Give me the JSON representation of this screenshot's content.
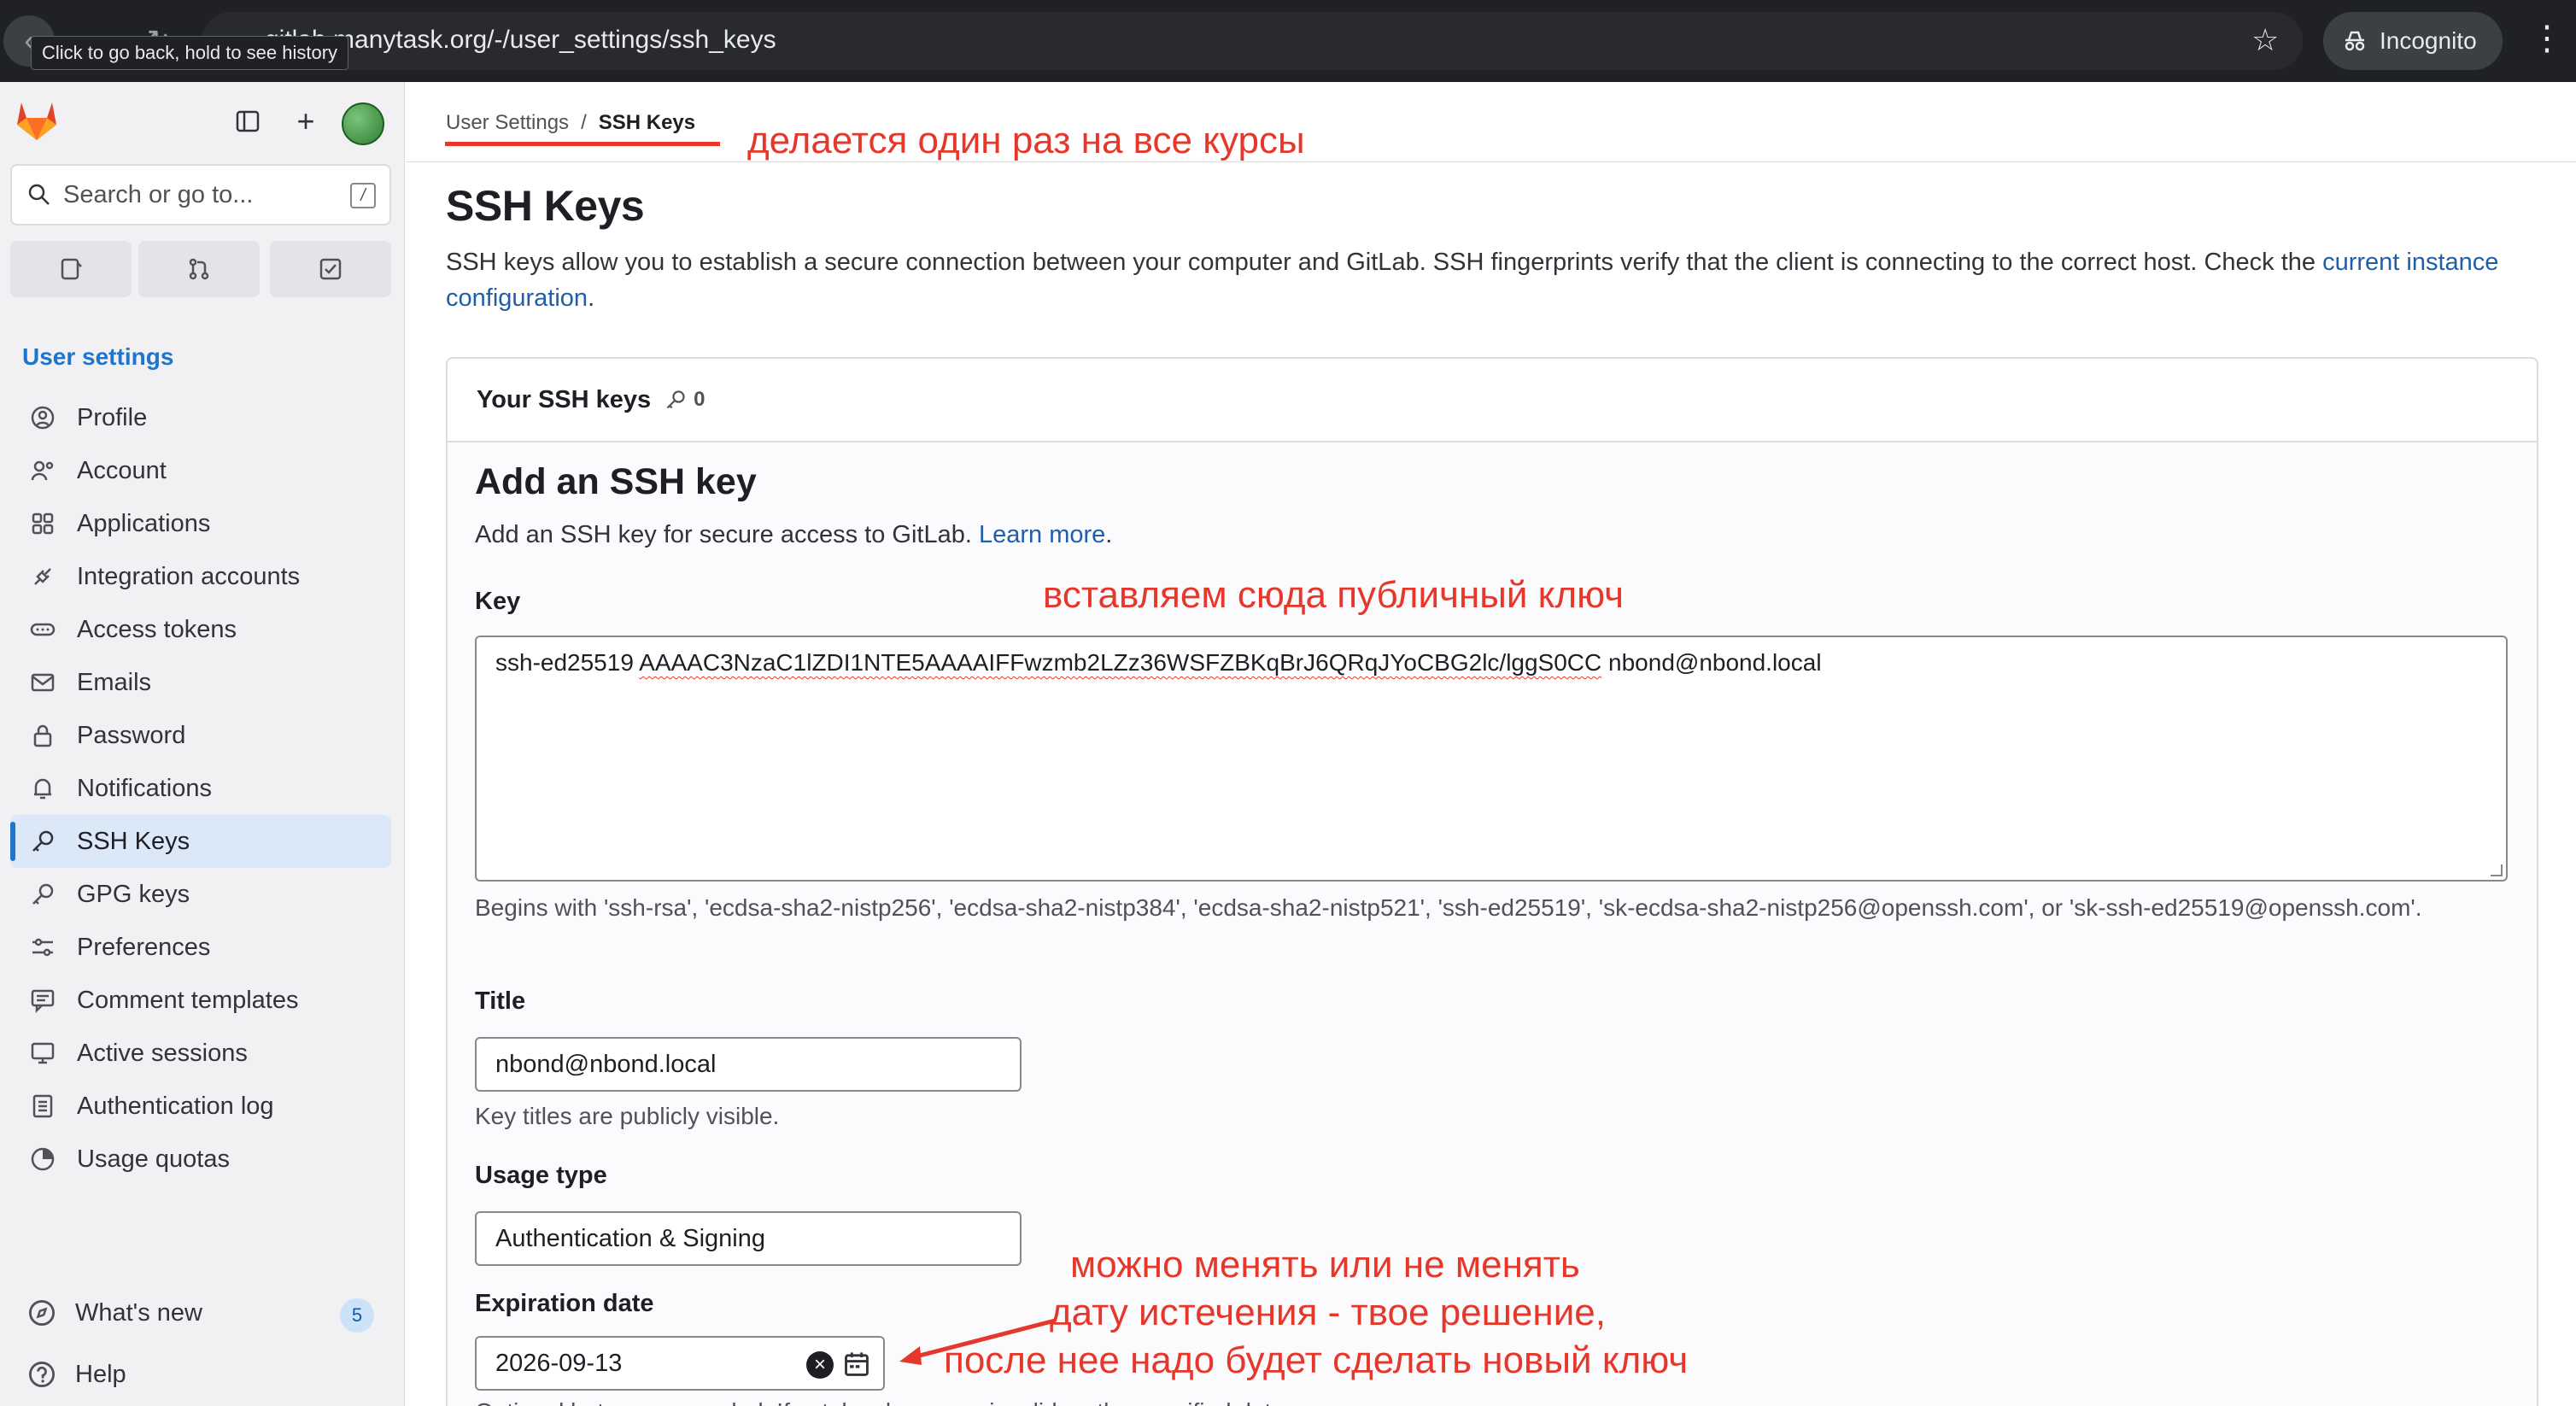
{
  "browser": {
    "url": "gitlab.manytask.org/-/user_settings/ssh_keys",
    "tooltip": "Click to go back, hold to see history",
    "incognito_label": "Incognito"
  },
  "sidebar": {
    "search_placeholder": "Search or go to...",
    "search_shortcut": "/",
    "heading": "User settings",
    "items": [
      {
        "label": "Profile",
        "icon": "profile-icon"
      },
      {
        "label": "Account",
        "icon": "account-icon"
      },
      {
        "label": "Applications",
        "icon": "applications-icon"
      },
      {
        "label": "Integration accounts",
        "icon": "integration-icon"
      },
      {
        "label": "Access tokens",
        "icon": "token-icon"
      },
      {
        "label": "Emails",
        "icon": "mail-icon"
      },
      {
        "label": "Password",
        "icon": "lock-icon"
      },
      {
        "label": "Notifications",
        "icon": "bell-icon"
      },
      {
        "label": "SSH Keys",
        "icon": "key-icon",
        "active": true
      },
      {
        "label": "GPG keys",
        "icon": "key-icon"
      },
      {
        "label": "Preferences",
        "icon": "preferences-icon"
      },
      {
        "label": "Comment templates",
        "icon": "comment-icon"
      },
      {
        "label": "Active sessions",
        "icon": "monitor-icon"
      },
      {
        "label": "Authentication log",
        "icon": "log-icon"
      },
      {
        "label": "Usage quotas",
        "icon": "quota-icon"
      }
    ],
    "whats_new": "What's new",
    "whats_new_count": "5",
    "help": "Help"
  },
  "breadcrumb": {
    "parent": "User Settings",
    "separator": "/",
    "current": "SSH Keys"
  },
  "page": {
    "title": "SSH Keys",
    "description_before": "SSH keys allow you to establish a secure connection between your computer and GitLab. SSH fingerprints verify that the client is connecting to the correct host. Check the ",
    "description_link": "current instance configuration",
    "description_after": "."
  },
  "card": {
    "header": "Your SSH keys",
    "count": "0",
    "form_title": "Add an SSH key",
    "form_sub_before": "Add an SSH key for secure access to GitLab. ",
    "form_sub_link": "Learn more",
    "form_sub_after": ".",
    "key_label": "Key",
    "key_value_prefix": "ssh-ed25519 ",
    "key_value_body": "AAAAC3NzaC1lZDI1NTE5AAAAIFFwzmb2LZz36WSFZBKqBrJ6QRqJYoCBG2lc/lggS0CC",
    "key_value_suffix": " nbond@nbond.local",
    "key_help": "Begins with 'ssh-rsa', 'ecdsa-sha2-nistp256', 'ecdsa-sha2-nistp384', 'ecdsa-sha2-nistp521', 'ssh-ed25519', 'sk-ecdsa-sha2-nistp256@openssh.com', or 'sk-ssh-ed25519@openssh.com'.",
    "title_label": "Title",
    "title_value": "nbond@nbond.local",
    "title_help": "Key titles are publicly visible.",
    "usage_label": "Usage type",
    "usage_value": "Authentication & Signing",
    "expiration_label": "Expiration date",
    "expiration_value": "2026-09-13",
    "expiration_help": "Optional but recommended. If set, key becomes invalid on the specified date."
  },
  "annotations": {
    "top": "делается один раз на все курсы",
    "key": "вставляем сюда публичный ключ",
    "date_line1": "можно менять или не менять",
    "date_line2": "дату истечения - твое решение,",
    "date_line3": "после нее надо будет сделать новый ключ",
    "color": "#e5372a"
  }
}
